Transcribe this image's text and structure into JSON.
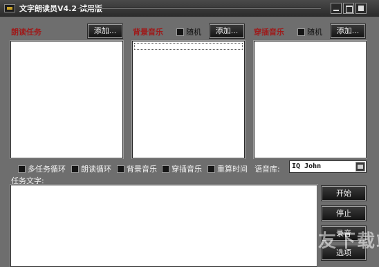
{
  "window": {
    "title": "文字朗读员V4.2 试用版"
  },
  "reading_task": {
    "label": "朗读任务",
    "add_button": "添加..."
  },
  "background_music": {
    "label": "背景音乐",
    "random_label": "随机",
    "add_button": "添加..."
  },
  "insert_music": {
    "label": "穿插音乐",
    "random_label": "随机",
    "add_button": "添加..."
  },
  "options": {
    "multi_task_loop": "多任务循环",
    "read_loop": "朗读循环",
    "background_music": "背景音乐",
    "insert_music": "穿插音乐",
    "repeat_time": "重算时间"
  },
  "voice": {
    "label": "语音库:",
    "value": "IQ John"
  },
  "task_text": {
    "label": "任务文字:",
    "value": ""
  },
  "actions": {
    "start": "开始",
    "stop": "停止",
    "record": "录音",
    "options": "选项"
  },
  "watermark": "久友下载站"
}
